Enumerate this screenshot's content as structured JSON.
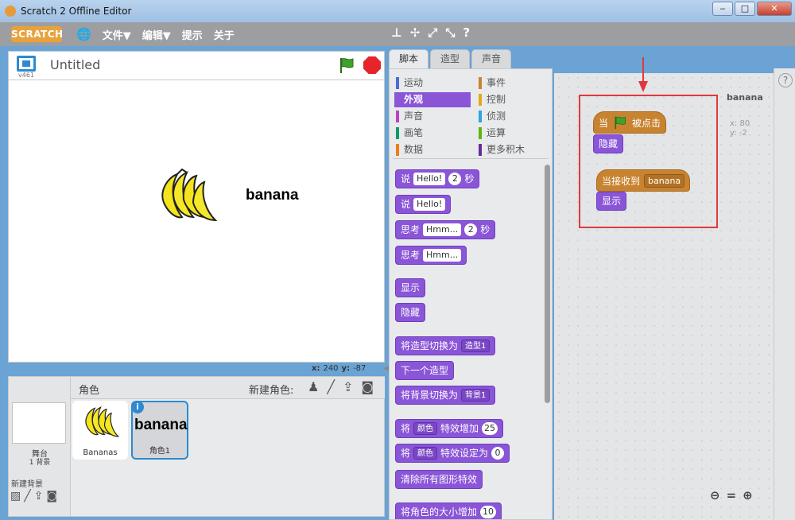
{
  "window": {
    "title": "Scratch 2 Offline Editor",
    "minimize": "‒",
    "maximize": "□",
    "close": "✕"
  },
  "menubar": {
    "logo": "SCRATCH",
    "file": "文件▼",
    "edit": "编辑▼",
    "tips": "提示",
    "about": "关于"
  },
  "stage_header": {
    "version": "v461",
    "project_title": "Untitled"
  },
  "stage": {
    "sprite_text": "banana",
    "x_label": "x:",
    "x_value": "240",
    "y_label": "y:",
    "y_value": "-87"
  },
  "sprite_pane": {
    "label": "角色",
    "new_sprite": "新建角色:",
    "stage_label": "舞台",
    "stage_sub": "1 背景",
    "new_backdrop": "新建背景",
    "sprites": [
      {
        "name": "Bananas"
      },
      {
        "name": "角色1",
        "thumb_text": "banana",
        "info": "i"
      }
    ]
  },
  "tabs": [
    "脚本",
    "造型",
    "声音"
  ],
  "categories": [
    {
      "label": "运动",
      "color": "#4a6cd4"
    },
    {
      "label": "事件",
      "color": "#c88330"
    },
    {
      "label": "外观",
      "color": "#8a55d7",
      "selected": true
    },
    {
      "label": "控制",
      "color": "#e1a91a"
    },
    {
      "label": "声音",
      "color": "#bb42c3"
    },
    {
      "label": "侦测",
      "color": "#2ca5e2"
    },
    {
      "label": "画笔",
      "color": "#0e9a6c"
    },
    {
      "label": "运算",
      "color": "#5cb712"
    },
    {
      "label": "数据",
      "color": "#ee7d16"
    },
    {
      "label": "更多积木",
      "color": "#632d99"
    }
  ],
  "palette_blocks": {
    "say_timed": {
      "text1": "说",
      "field": "Hello!",
      "num": "2",
      "text2": "秒"
    },
    "say": {
      "text1": "说",
      "field": "Hello!"
    },
    "think_timed": {
      "text1": "思考",
      "field": "Hmm...",
      "num": "2",
      "text2": "秒"
    },
    "think": {
      "text1": "思考",
      "field": "Hmm..."
    },
    "show": "显示",
    "hide": "隐藏",
    "switch_costume": {
      "text": "将造型切换为",
      "drop": "造型1"
    },
    "next_costume": "下一个造型",
    "switch_backdrop": {
      "text": "将背景切换为",
      "drop": "背景1"
    },
    "change_effect": {
      "text1": "将",
      "drop": "颜色",
      "text2": "特效增加",
      "num": "25"
    },
    "set_effect": {
      "text1": "将",
      "drop": "颜色",
      "text2": "特效设定为",
      "num": "0"
    },
    "clear_effects": "清除所有图形特效",
    "change_size": {
      "text": "将角色的大小增加",
      "num": "10"
    }
  },
  "script_area": {
    "sprite_name": "banana",
    "x_readout": "x: 80",
    "y_readout": "y: -2",
    "help": "?",
    "script1": {
      "hat_text1": "当",
      "hat_text2": "被点击",
      "block": "隐藏"
    },
    "script2": {
      "hat_text": "当接收到",
      "drop": "banana",
      "block": "显示"
    }
  },
  "colors": {
    "looks": "#8a55d7",
    "events": "#c88330",
    "highlight": "#e0393c",
    "selection": "#2d8ad2"
  }
}
